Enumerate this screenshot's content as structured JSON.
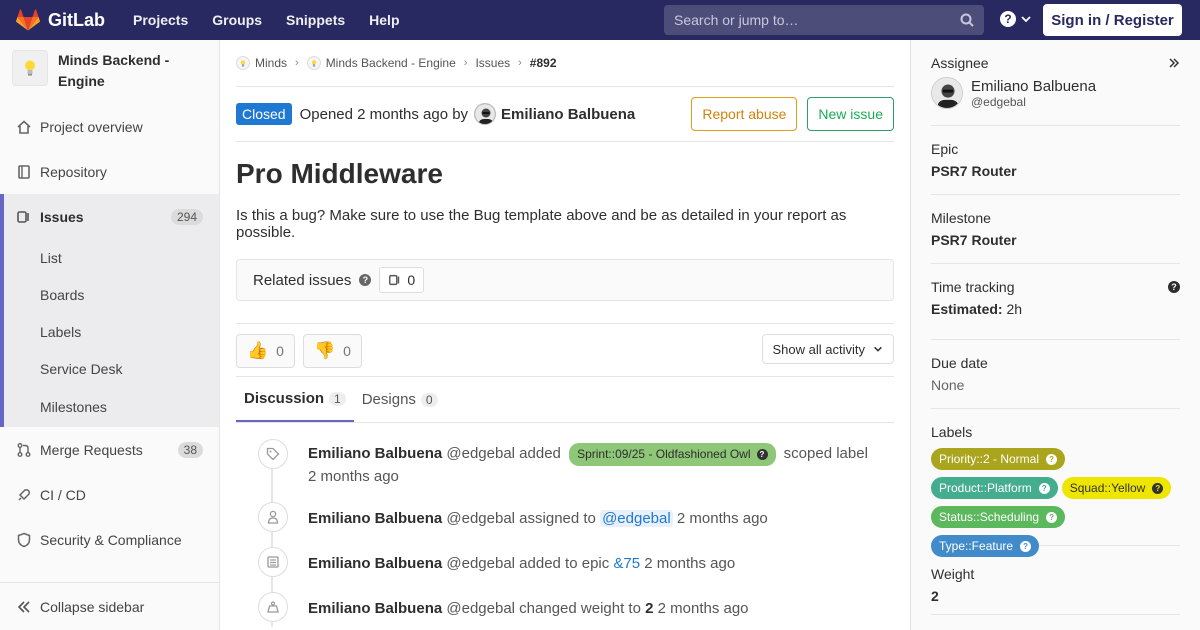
{
  "navbar": {
    "brand": "GitLab",
    "links": [
      "Projects",
      "Groups",
      "Snippets",
      "Help"
    ],
    "search_placeholder": "Search or jump to…",
    "signin_label": "Sign in / Register"
  },
  "sidebar": {
    "project_name": "Minds Backend - Engine",
    "items": {
      "overview": "Project overview",
      "repository": "Repository",
      "issues": "Issues",
      "issues_count": "294",
      "merge_requests": "Merge Requests",
      "merge_requests_count": "38",
      "cicd": "CI / CD",
      "security": "Security & Compliance"
    },
    "sub_items": [
      "List",
      "Boards",
      "Labels",
      "Service Desk",
      "Milestones"
    ],
    "collapse_label": "Collapse sidebar"
  },
  "breadcrumb": {
    "group": "Minds",
    "project": "Minds Backend - Engine",
    "section": "Issues",
    "issue": "#892"
  },
  "issue": {
    "status": "Closed",
    "opened_text": "Opened 2 months ago by",
    "author": "Emiliano Balbuena",
    "report_abuse": "Report abuse",
    "new_issue": "New issue",
    "title": "Pro Middleware",
    "description": "Is this a bug? Make sure to use the Bug template above and be as detailed in your report as possible.",
    "related_label": "Related issues",
    "related_count": "0",
    "thumbs_up": "0",
    "thumbs_down": "0",
    "activity_filter": "Show all activity",
    "tabs": {
      "discussion": "Discussion",
      "discussion_count": "1",
      "designs": "Designs",
      "designs_count": "0"
    }
  },
  "timeline": [
    {
      "author": "Emiliano Balbuena",
      "handle": "@edgebal",
      "action": "added",
      "label": "Sprint::09/25 - Oldfashioned Owl",
      "suffix": "scoped label",
      "time": "2 months ago"
    },
    {
      "author": "Emiliano Balbuena",
      "handle": "@edgebal",
      "action": "assigned to",
      "mention": "@edgebal",
      "time": "2 months ago"
    },
    {
      "author": "Emiliano Balbuena",
      "handle": "@edgebal",
      "action": "added to epic",
      "epic": "&75",
      "time": "2 months ago"
    },
    {
      "author": "Emiliano Balbuena",
      "handle": "@edgebal",
      "action": "changed weight to",
      "weight": "2",
      "time": "2 months ago"
    }
  ],
  "right_sidebar": {
    "assignee_label": "Assignee",
    "assignee_name": "Emiliano Balbuena",
    "assignee_handle": "@edgebal",
    "epic_label": "Epic",
    "epic_value": "PSR7 Router",
    "milestone_label": "Milestone",
    "milestone_value": "PSR7 Router",
    "time_label": "Time tracking",
    "estimated_label": "Estimated:",
    "estimated_value": "2h",
    "due_label": "Due date",
    "due_value": "None",
    "labels_label": "Labels",
    "labels": [
      {
        "text": "Priority::2 - Normal",
        "color": "#aaa51c",
        "fg": "#ffffff"
      },
      {
        "text": "Product::Platform",
        "color": "#44ad8e",
        "fg": "#ffffff"
      },
      {
        "text": "Squad::Yellow",
        "color": "#eee600",
        "fg": "#333333"
      },
      {
        "text": "Status::Scheduling",
        "color": "#5cb85c",
        "fg": "#ffffff"
      },
      {
        "text": "Type::Feature",
        "color": "#428bca",
        "fg": "#ffffff"
      }
    ],
    "weight_label": "Weight",
    "weight_value": "2"
  },
  "colors": {
    "navbar": "#292961",
    "accent": "#6666c4",
    "closed": "#1f78d1",
    "sprint_label": "#8fc778"
  }
}
